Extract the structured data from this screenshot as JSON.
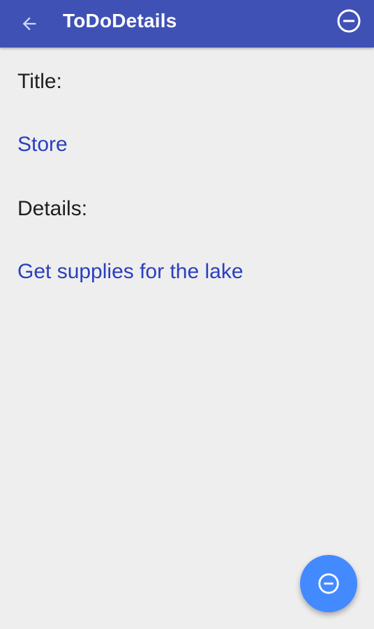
{
  "app_bar": {
    "title": "ToDoDetails",
    "back_icon": "arrow-back-icon",
    "action_icon": "remove-circle-icon",
    "background": "#3f51b5"
  },
  "details": {
    "title_label": "Title:",
    "title_value": "Store",
    "details_label": "Details:",
    "details_value": "Get supplies for the lake"
  },
  "fab": {
    "icon": "remove-circle-icon",
    "color": "#448aff"
  },
  "colors": {
    "background": "#eeeeee",
    "value_text": "#2a3fbf",
    "label_text": "#202020"
  }
}
